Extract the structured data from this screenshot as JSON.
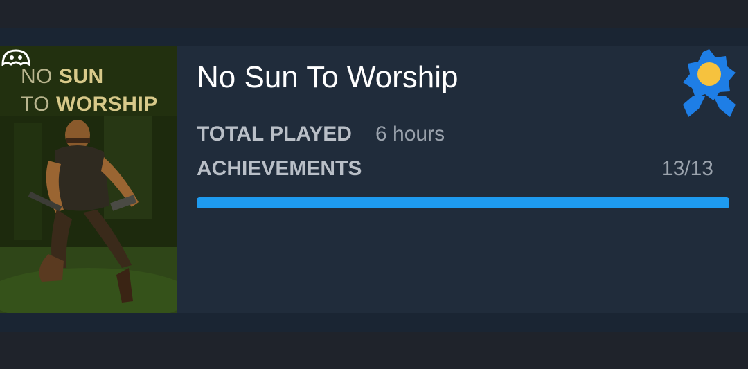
{
  "game": {
    "title": "No Sun To Worship",
    "cover": {
      "title_line1_a": "NO ",
      "title_line1_b": "SUN",
      "title_line2_a": "TO ",
      "title_line2_b": "WORSHIP"
    },
    "total_played_label": "TOTAL PLAYED",
    "total_played_value": "6 hours",
    "achievements_label": "ACHIEVEMENTS",
    "achievements_value": "13/13",
    "achievements_progress": 1.0
  },
  "colors": {
    "accent": "#1e9bf0",
    "badge_blue": "#1e7ee6",
    "badge_gold": "#f6c23e"
  },
  "icons": {
    "badge": "perfect-completion-ribbon-icon",
    "publisher_logo": "publisher-logo-icon"
  }
}
